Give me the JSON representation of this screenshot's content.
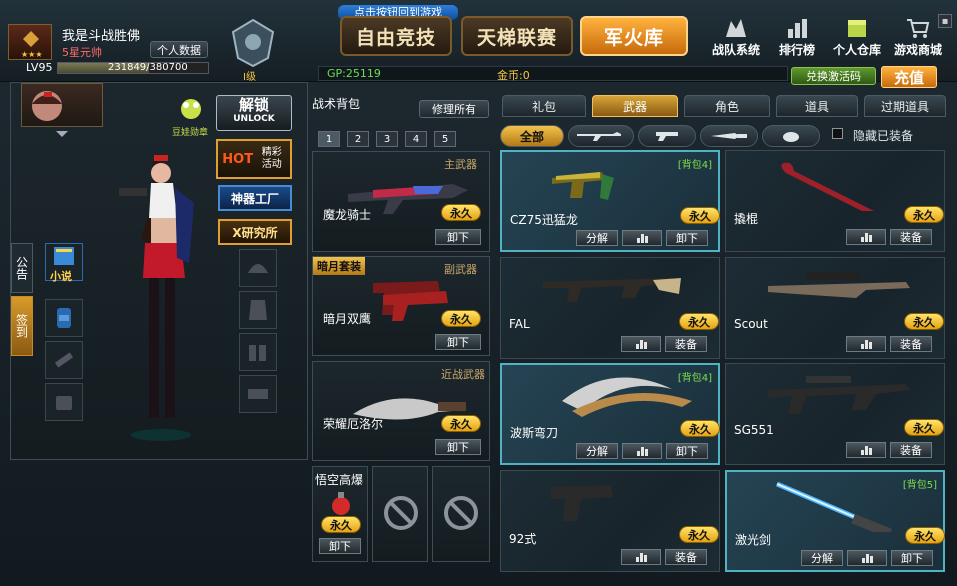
{
  "header": {
    "player_name": "我是斗战胜佛",
    "rank_title": "5星元帅",
    "profile_button": "个人数据",
    "level": "LV95",
    "exp": "231849/380700",
    "exp_fraction": 0.609,
    "tier_label": "I级",
    "return_hint": "点击按钮回到游戏",
    "nav": [
      "自由竞技",
      "天梯联赛",
      "军火库"
    ],
    "nav_active": 2,
    "top_icons": [
      "战队系统",
      "排行榜",
      "个人仓库",
      "游戏商城"
    ],
    "gp": "GP:25119",
    "gold": "金币:0",
    "redeem_button": "兑换激活码",
    "recharge_button": "充值"
  },
  "left": {
    "unlock_label": "解锁",
    "unlock_sub": "UNLOCK",
    "badge_label": "豆娃勋章",
    "hot_label": "HOT",
    "hot_sub": "精彩活动",
    "artifact_label": "神器工厂",
    "research_label": "X研究所",
    "side_tabs": [
      "公告",
      "签到"
    ],
    "novel_label": "小说"
  },
  "tactical": {
    "title": "战术背包",
    "repair_button": "修理所有",
    "pages": [
      "1",
      "2",
      "3",
      "4",
      "5"
    ],
    "slots": [
      {
        "slot_label": "主武器",
        "name": "魔龙骑士",
        "status": "永久",
        "action": "卸下"
      },
      {
        "slot_label": "副武器",
        "badge": "暗月套装",
        "name": "暗月双鹰",
        "status": "永久",
        "action": "卸下"
      },
      {
        "slot_label": "近战武器",
        "name": "荣耀厄洛尔",
        "status": "永久",
        "action": "卸下"
      }
    ],
    "grenade": {
      "name": "悟空高爆",
      "status": "永久",
      "action": "卸下"
    }
  },
  "inventory": {
    "tabs": [
      "礼包",
      "武器",
      "角色",
      "道具",
      "过期道具"
    ],
    "tab_active": 1,
    "filter_all": "全部",
    "hide_equipped": "隐藏已装备",
    "items": [
      {
        "name": "CZ75迅猛龙",
        "tag": "[背包4]",
        "status": "永久",
        "actions": [
          "分解",
          "stats",
          "卸下"
        ],
        "highlighted": true
      },
      {
        "name": "撬棍",
        "tag": "",
        "status": "永久",
        "actions": [
          "stats",
          "装备"
        ],
        "highlighted": false
      },
      {
        "name": "FAL",
        "tag": "",
        "status": "永久",
        "actions": [
          "stats",
          "装备"
        ],
        "highlighted": false
      },
      {
        "name": "Scout",
        "tag": "",
        "status": "永久",
        "actions": [
          "stats",
          "装备"
        ],
        "highlighted": false
      },
      {
        "name": "波斯弯刀",
        "tag": "[背包4]",
        "status": "永久",
        "actions": [
          "分解",
          "stats",
          "卸下"
        ],
        "highlighted": true
      },
      {
        "name": "SG551",
        "tag": "",
        "status": "永久",
        "actions": [
          "stats",
          "装备"
        ],
        "highlighted": false
      },
      {
        "name": "92式",
        "tag": "",
        "status": "永久",
        "actions": [
          "stats",
          "装备"
        ],
        "highlighted": false
      },
      {
        "name": "激光剑",
        "tag": "[背包5]",
        "status": "永久",
        "actions": [
          "分解",
          "stats",
          "卸下"
        ],
        "highlighted": true
      }
    ]
  },
  "colors": {
    "accent_gold": "#f4c542",
    "highlight_cyan": "#4fb3c4",
    "tag_green": "#7fe04c"
  }
}
